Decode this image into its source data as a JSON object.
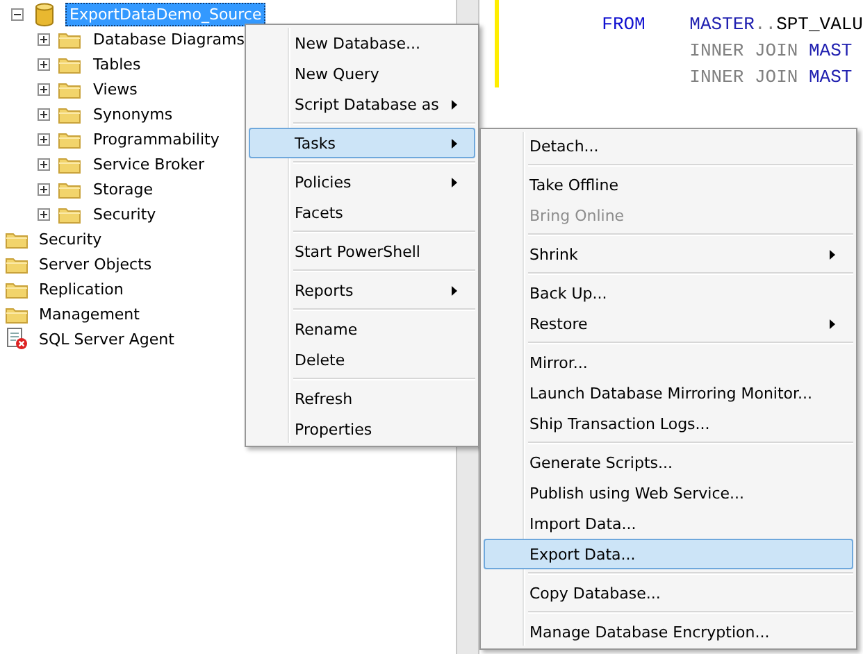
{
  "object_explorer": {
    "database_tree": [
      {
        "label": "ExportDataDemo_Source",
        "kind": "database",
        "expanded": true,
        "selected": true,
        "children": [
          {
            "label": "Database Diagrams",
            "kind": "folder",
            "expanded": false
          },
          {
            "label": "Tables",
            "kind": "folder",
            "expanded": false
          },
          {
            "label": "Views",
            "kind": "folder",
            "expanded": false
          },
          {
            "label": "Synonyms",
            "kind": "folder",
            "expanded": false
          },
          {
            "label": "Programmability",
            "kind": "folder",
            "expanded": false
          },
          {
            "label": "Service Broker",
            "kind": "folder",
            "expanded": false
          },
          {
            "label": "Storage",
            "kind": "folder",
            "expanded": false
          },
          {
            "label": "Security",
            "kind": "folder",
            "expanded": false
          }
        ]
      }
    ],
    "server_nodes": [
      {
        "label": "Security",
        "kind": "folder"
      },
      {
        "label": "Server Objects",
        "kind": "folder"
      },
      {
        "label": "Replication",
        "kind": "folder"
      },
      {
        "label": "Management",
        "kind": "folder"
      },
      {
        "label": "SQL Server Agent",
        "kind": "agent"
      }
    ]
  },
  "query_editor": {
    "lines": [
      {
        "lead": [
          {
            "text": "FROM",
            "kind": "keyword"
          }
        ],
        "body": [
          {
            "text": "MASTER",
            "kind": "object"
          },
          {
            "text": "..",
            "kind": "operator"
          },
          {
            "text": "SPT_VALU",
            "kind": "plain"
          }
        ]
      },
      {
        "body": [
          {
            "text": "INNER JOIN",
            "kind": "operator"
          },
          {
            "text": "MAST",
            "kind": "object"
          }
        ]
      },
      {
        "body": [
          {
            "text": "INNER JOIN",
            "kind": "operator"
          },
          {
            "text": "MAST",
            "kind": "object"
          }
        ]
      }
    ]
  },
  "context_menu": {
    "groups": [
      [
        {
          "label": "New Database...",
          "submenu": false,
          "selected": false
        },
        {
          "label": "New Query",
          "submenu": false,
          "selected": false
        },
        {
          "label": "Script Database as",
          "submenu": true,
          "selected": false
        }
      ],
      [
        {
          "label": "Tasks",
          "submenu": true,
          "selected": true
        }
      ],
      [
        {
          "label": "Policies",
          "submenu": true,
          "selected": false
        },
        {
          "label": "Facets",
          "submenu": false,
          "selected": false
        }
      ],
      [
        {
          "label": "Start PowerShell",
          "submenu": false,
          "selected": false
        }
      ],
      [
        {
          "label": "Reports",
          "submenu": true,
          "selected": false
        }
      ],
      [
        {
          "label": "Rename",
          "submenu": false,
          "selected": false
        },
        {
          "label": "Delete",
          "submenu": false,
          "selected": false
        }
      ],
      [
        {
          "label": "Refresh",
          "submenu": false,
          "selected": false
        },
        {
          "label": "Properties",
          "submenu": false,
          "selected": false
        }
      ]
    ]
  },
  "tasks_submenu": {
    "groups": [
      [
        {
          "label": "Detach...",
          "submenu": false,
          "selected": false,
          "disabled": false
        }
      ],
      [
        {
          "label": "Take Offline",
          "submenu": false,
          "selected": false,
          "disabled": false
        },
        {
          "label": "Bring Online",
          "submenu": false,
          "selected": false,
          "disabled": true
        }
      ],
      [
        {
          "label": "Shrink",
          "submenu": true,
          "selected": false,
          "disabled": false
        }
      ],
      [
        {
          "label": "Back Up...",
          "submenu": false,
          "selected": false,
          "disabled": false
        },
        {
          "label": "Restore",
          "submenu": true,
          "selected": false,
          "disabled": false
        }
      ],
      [
        {
          "label": "Mirror...",
          "submenu": false,
          "selected": false,
          "disabled": false
        },
        {
          "label": "Launch Database Mirroring Monitor...",
          "submenu": false,
          "selected": false,
          "disabled": false
        },
        {
          "label": "Ship Transaction Logs...",
          "submenu": false,
          "selected": false,
          "disabled": false
        }
      ],
      [
        {
          "label": "Generate Scripts...",
          "submenu": false,
          "selected": false,
          "disabled": false
        },
        {
          "label": "Publish using Web Service...",
          "submenu": false,
          "selected": false,
          "disabled": false
        },
        {
          "label": "Import Data...",
          "submenu": false,
          "selected": false,
          "disabled": false
        },
        {
          "label": "Export Data...",
          "submenu": false,
          "selected": true,
          "disabled": false
        }
      ],
      [
        {
          "label": "Copy Database...",
          "submenu": false,
          "selected": false,
          "disabled": false
        }
      ],
      [
        {
          "label": "Manage Database Encryption...",
          "submenu": false,
          "selected": false,
          "disabled": false
        }
      ]
    ]
  }
}
